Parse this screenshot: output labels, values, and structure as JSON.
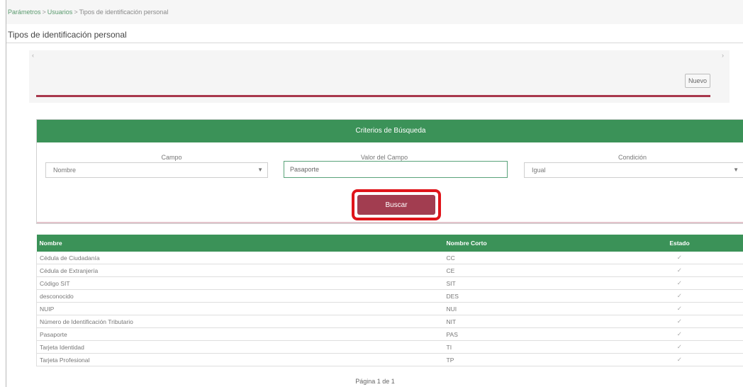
{
  "breadcrumb": {
    "items": [
      "Parámetros",
      "Usuarios"
    ],
    "separator": ">",
    "current": "Tipos de identificación personal"
  },
  "page": {
    "title": "Tipos de identificación personal"
  },
  "toolbar": {
    "nuevo_label": "Nuevo"
  },
  "search": {
    "header": "Criterios de Búsqueda",
    "campo_label": "Campo",
    "campo_value": "Nombre",
    "valor_label": "Valor del Campo",
    "valor_value": "Pasaporte",
    "condicion_label": "Condición",
    "condicion_value": "Igual",
    "buscar_label": "Buscar"
  },
  "table": {
    "headers": [
      "Nombre",
      "Nombre Corto",
      "Estado"
    ],
    "rows": [
      {
        "nombre": "Cédula de Ciudadanía",
        "corto": "CC",
        "estado": "✓"
      },
      {
        "nombre": "Cédula de Extranjería",
        "corto": "CE",
        "estado": "✓"
      },
      {
        "nombre": "Código SIT",
        "corto": "SIT",
        "estado": "✓"
      },
      {
        "nombre": "desconocido",
        "corto": "DES",
        "estado": "✓"
      },
      {
        "nombre": "NUIP",
        "corto": "NUI",
        "estado": "✓"
      },
      {
        "nombre": "Número de Identificación Tributario",
        "corto": "NIT",
        "estado": "✓"
      },
      {
        "nombre": "Pasaporte",
        "corto": "PAS",
        "estado": "✓"
      },
      {
        "nombre": "Tarjeta Identidad",
        "corto": "TI",
        "estado": "✓"
      },
      {
        "nombre": "Tarjeta Profesional",
        "corto": "TP",
        "estado": "✓"
      }
    ]
  },
  "pager": {
    "text": "Página 1 de 1"
  },
  "colors": {
    "green": "#3b9258",
    "buscar": "#a23d50",
    "highlight": "#e0141a",
    "rule": "#a8384c"
  }
}
